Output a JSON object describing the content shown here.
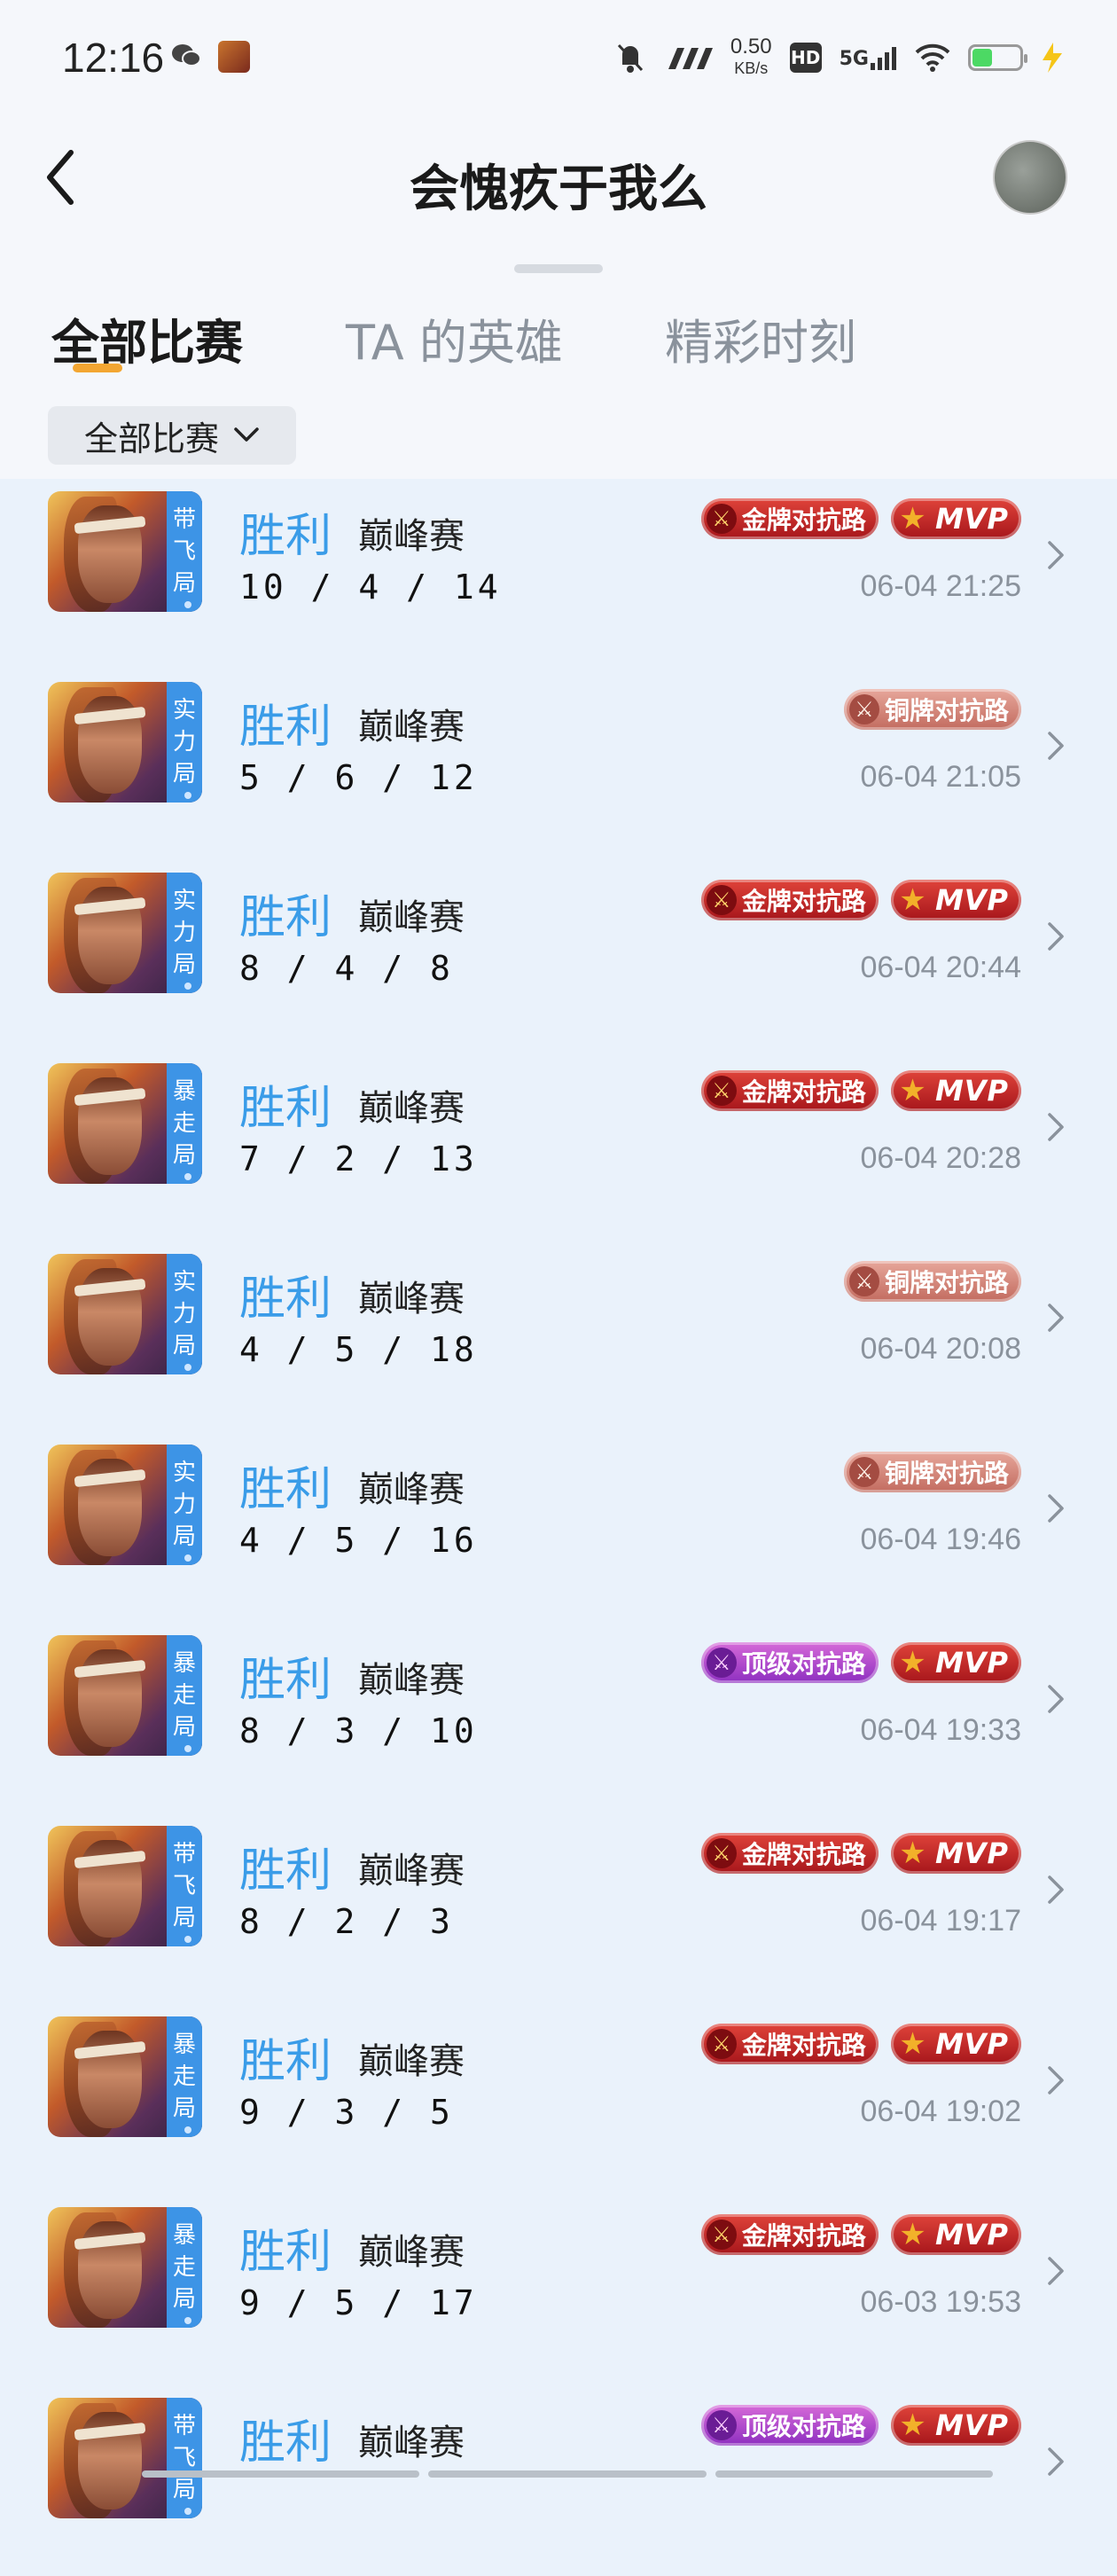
{
  "status_bar": {
    "time": "12:16",
    "net_speed_value": "0.50",
    "net_speed_unit": "KB/s",
    "hd_label": "HD",
    "network_label": "5G",
    "battery_level": 0.4
  },
  "header": {
    "title": "会愧疚于我么",
    "back_icon": "chevron-left-icon"
  },
  "tabs": [
    {
      "label": "全部比赛",
      "active": true
    },
    {
      "label": "TA 的英雄",
      "active": false
    },
    {
      "label": "精彩时刻",
      "active": false
    }
  ],
  "filter": {
    "label": "全部比赛",
    "icon": "chevron-down-icon"
  },
  "matches": [
    {
      "mode_tag": [
        "带",
        "飞",
        "局"
      ],
      "result": "胜利",
      "match_type": "巅峰赛",
      "kda": "10 / 4 / 14",
      "badges": [
        {
          "kind": "gold",
          "label": "金牌对抗路"
        },
        {
          "kind": "mvp",
          "label": "MVP"
        }
      ],
      "time": "06-04 21:25"
    },
    {
      "mode_tag": [
        "实",
        "力",
        "局"
      ],
      "result": "胜利",
      "match_type": "巅峰赛",
      "kda": "5 / 6 / 12",
      "badges": [
        {
          "kind": "bronze",
          "label": "铜牌对抗路"
        }
      ],
      "time": "06-04 21:05"
    },
    {
      "mode_tag": [
        "实",
        "力",
        "局"
      ],
      "result": "胜利",
      "match_type": "巅峰赛",
      "kda": "8 / 4 / 8",
      "badges": [
        {
          "kind": "gold",
          "label": "金牌对抗路"
        },
        {
          "kind": "mvp",
          "label": "MVP"
        }
      ],
      "time": "06-04 20:44"
    },
    {
      "mode_tag": [
        "暴",
        "走",
        "局"
      ],
      "result": "胜利",
      "match_type": "巅峰赛",
      "kda": "7 / 2 / 13",
      "badges": [
        {
          "kind": "gold",
          "label": "金牌对抗路"
        },
        {
          "kind": "mvp",
          "label": "MVP"
        }
      ],
      "time": "06-04 20:28"
    },
    {
      "mode_tag": [
        "实",
        "力",
        "局"
      ],
      "result": "胜利",
      "match_type": "巅峰赛",
      "kda": "4 / 5 / 18",
      "badges": [
        {
          "kind": "bronze",
          "label": "铜牌对抗路"
        }
      ],
      "time": "06-04 20:08"
    },
    {
      "mode_tag": [
        "实",
        "力",
        "局"
      ],
      "result": "胜利",
      "match_type": "巅峰赛",
      "kda": "4 / 5 / 16",
      "badges": [
        {
          "kind": "bronze",
          "label": "铜牌对抗路"
        }
      ],
      "time": "06-04 19:46"
    },
    {
      "mode_tag": [
        "暴",
        "走",
        "局"
      ],
      "result": "胜利",
      "match_type": "巅峰赛",
      "kda": "8 / 3 / 10",
      "badges": [
        {
          "kind": "top",
          "label": "顶级对抗路"
        },
        {
          "kind": "mvp",
          "label": "MVP"
        }
      ],
      "time": "06-04 19:33"
    },
    {
      "mode_tag": [
        "带",
        "飞",
        "局"
      ],
      "result": "胜利",
      "match_type": "巅峰赛",
      "kda": "8 / 2 / 3",
      "badges": [
        {
          "kind": "gold",
          "label": "金牌对抗路"
        },
        {
          "kind": "mvp",
          "label": "MVP"
        }
      ],
      "time": "06-04 19:17"
    },
    {
      "mode_tag": [
        "暴",
        "走",
        "局"
      ],
      "result": "胜利",
      "match_type": "巅峰赛",
      "kda": "9 / 3 / 5",
      "badges": [
        {
          "kind": "gold",
          "label": "金牌对抗路"
        },
        {
          "kind": "mvp",
          "label": "MVP"
        }
      ],
      "time": "06-04 19:02"
    },
    {
      "mode_tag": [
        "暴",
        "走",
        "局"
      ],
      "result": "胜利",
      "match_type": "巅峰赛",
      "kda": "9 / 5 / 17",
      "badges": [
        {
          "kind": "gold",
          "label": "金牌对抗路"
        },
        {
          "kind": "mvp",
          "label": "MVP"
        }
      ],
      "time": "06-03 19:53"
    },
    {
      "mode_tag": [
        "带",
        "飞",
        "局"
      ],
      "result": "胜利",
      "match_type": "巅峰赛",
      "kda": "",
      "badges": [
        {
          "kind": "top",
          "label": "顶级对抗路"
        },
        {
          "kind": "mvp",
          "label": "MVP"
        }
      ],
      "time": ""
    }
  ],
  "colors": {
    "accent_blue": "#3a9ce8",
    "tab_underline": "#f3a632",
    "page_bg": "#eaf2fb"
  }
}
